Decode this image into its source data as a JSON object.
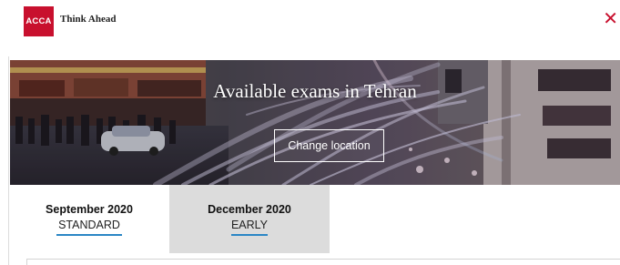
{
  "header": {
    "logo_text": "ACCA",
    "tagline": "Think Ahead",
    "close_icon": "close-icon",
    "brand_color": "#c8102e"
  },
  "hero": {
    "title": "Available exams in Tehran",
    "change_location_label": "Change location"
  },
  "tabs": [
    {
      "month": "September 2020",
      "type": "STANDARD",
      "selected": false
    },
    {
      "month": "December 2020",
      "type": "EARLY",
      "selected": true
    }
  ],
  "colors": {
    "tab_underline": "#2b86c5",
    "selected_tab_bg": "#dcdcdc"
  }
}
